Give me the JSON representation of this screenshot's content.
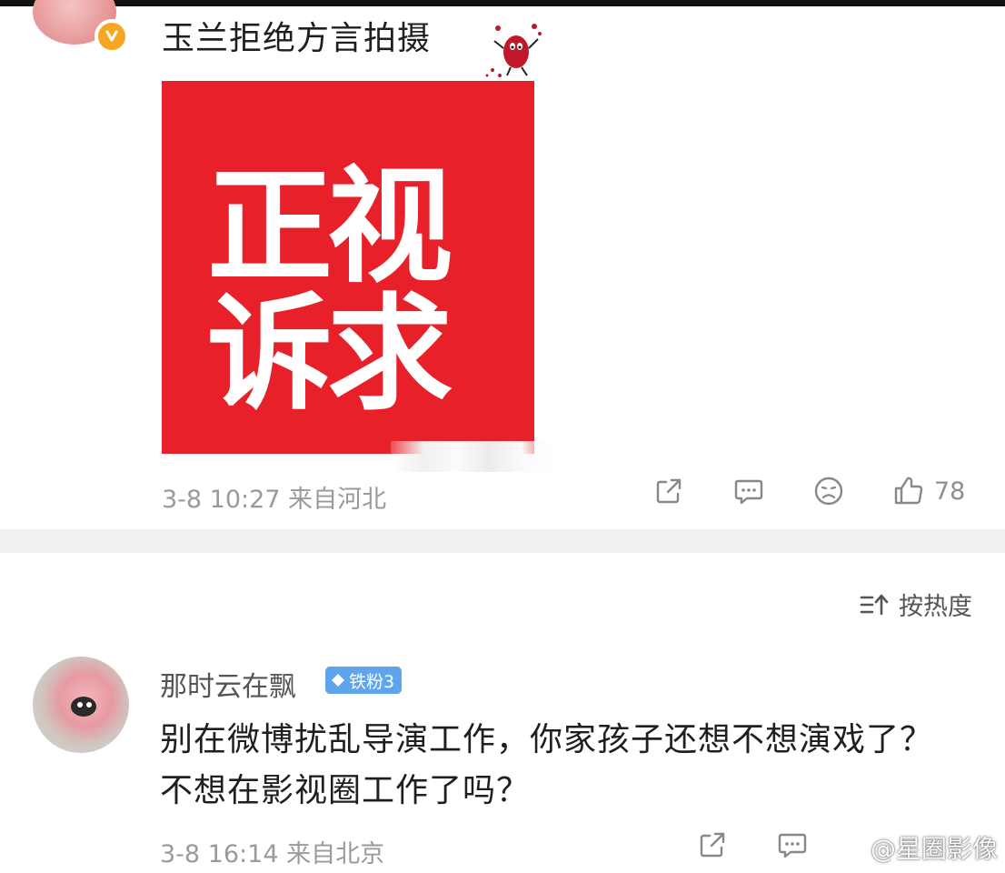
{
  "post": {
    "text": "玉兰拒绝方言拍摄",
    "image_text_line1": "正视",
    "image_text_line2": "诉求",
    "time": "3-8 10:27",
    "location": "来自河北",
    "like_count": "78"
  },
  "comments": {
    "sort_label": "按热度",
    "items": [
      {
        "username": "那时云在飘",
        "badge": "铁粉3",
        "text": "别在微博扰乱导演工作，你家孩子还想不想演戏了？不想在影视圈工作了吗？",
        "time": "3-8 16:14",
        "location": "来自北京"
      }
    ]
  },
  "watermark": {
    "text": "@星圈影像"
  },
  "icons": {
    "verified": "verified-badge-icon",
    "share": "share-icon",
    "comment": "comment-icon",
    "dislike": "sad-face-icon",
    "like": "thumbs-up-icon",
    "sort": "sort-icon",
    "weibo": "weibo-logo-icon"
  },
  "colors": {
    "accent_red": "#e8202a",
    "verified_orange": "#f5a623",
    "fan_badge_blue": "#5fa5ee",
    "meta_gray": "#9a9a9a"
  }
}
